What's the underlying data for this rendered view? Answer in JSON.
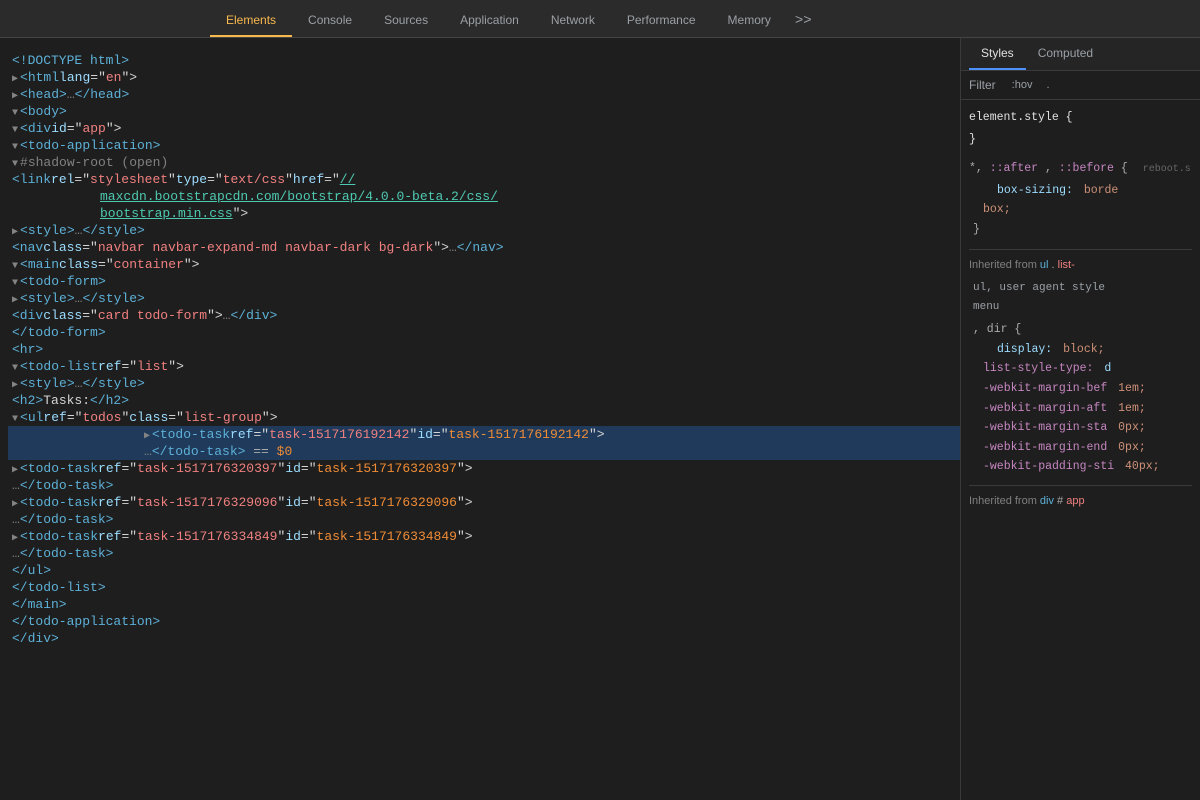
{
  "toolbar": {
    "tabs": [
      {
        "label": "Elements",
        "active": true
      },
      {
        "label": "Console",
        "active": false
      },
      {
        "label": "Sources",
        "active": false
      },
      {
        "label": "Application",
        "active": false
      },
      {
        "label": "Network",
        "active": false
      },
      {
        "label": "Performance",
        "active": false
      },
      {
        "label": "Memory",
        "active": false
      }
    ],
    "more_label": ">>"
  },
  "styles_panel": {
    "tabs": [
      "Styles",
      "Computed"
    ],
    "active_tab": "Styles",
    "filter_placeholder": "Filter",
    "hov_label": ":hov",
    "dot_label": "."
  },
  "dom": {
    "lines": [
      "<!DOCTYPE html>",
      "<html lang=\"en\">",
      "▶<head>…</head>",
      "▼<body>",
      "  ▼<div id=\"app\">",
      "    ▼<todo-application>",
      "      ▼#shadow-root (open)",
      "        <link rel=\"stylesheet\" type=\"text/css\" href=\"//",
      "        maxcdn.bootstrapcdn.com/bootstrap/4.0.0-beta.2/css/",
      "        bootstrap.min.css\">",
      "        ▶<style>…</style>",
      "        <nav class=\"navbar navbar-expand-md navbar-dark bg-dark\">…</nav>",
      "        ▼<main class=\"container\">",
      "          ▼<todo-form>",
      "            ▶<style>…</style>",
      "            <div class=\"card todo-form\">…</div>",
      "          </todo-form>",
      "          <hr>",
      "          ▼<todo-list ref=\"list\">",
      "            ▶<style>…</style>",
      "            <h2>Tasks:</h2>",
      "            ▼<ul ref=\"todos\" class=\"list-group\">",
      "              ▶<todo-task ref=\"task-1517176192142\" id=\"task-1517176192142\">",
      "              …</todo-task> == $0",
      "              ▶<todo-task ref=\"task-1517176320397\" id=\"task-1517176320397\">",
      "              …</todo-task>",
      "              ▶<todo-task ref=\"task-1517176329096\" id=\"task-1517176329096\">",
      "              …</todo-task>",
      "              ▶<todo-task ref=\"task-1517176334849\" id=\"task-1517176334849\">",
      "              …</todo-task>",
      "            </ul>",
      "          </todo-list>",
      "          </main>",
      "        </todo-application>",
      "        </div>"
    ]
  },
  "styles": {
    "element_style_label": "element.style {",
    "element_style_close": "}",
    "rules": [
      {
        "selector": "*, ::after, ::before {",
        "source": "reboot.s",
        "properties": [
          {
            "name": "box-sizing:",
            "value": "borde"
          },
          {
            "name": "",
            "value": "box;"
          }
        ]
      }
    ],
    "inherited_from_label": "Inherited from",
    "inherited_1": "ul.list-",
    "inherited_2": "ul,  user agent style",
    "inherited_3": "menu",
    "dir_rule": "dir {",
    "dir_props": [
      {
        "name": "display:",
        "value": "block;"
      },
      {
        "name": "list-style-type:",
        "value": "d",
        "webkit": true
      },
      {
        "name": "-webkit-margin-bef",
        "value": "1em;"
      },
      {
        "name": "-webkit-margin-aft",
        "value": "1em;"
      },
      {
        "name": "-webkit-margin-sta",
        "value": "0px;"
      },
      {
        "name": "-webkit-margin-end",
        "value": "0px;"
      },
      {
        "name": "-webkit-padding-sti",
        "value": "40px;"
      }
    ],
    "inherited_from_2": "Inherited from",
    "inherited_from_2_tag": "div",
    "inherited_from_2_attr": "#app"
  }
}
